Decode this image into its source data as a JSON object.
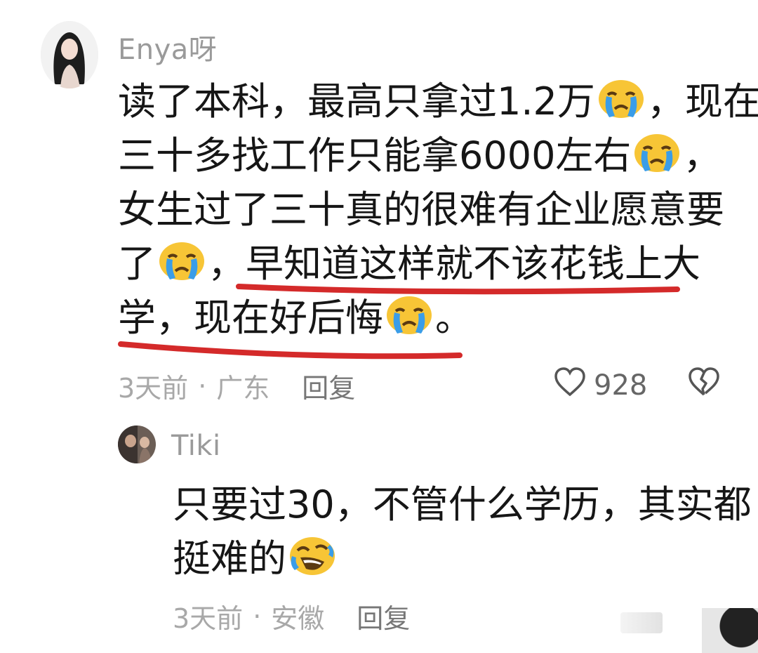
{
  "comments": [
    {
      "username": "Enya呀",
      "lines": [
        {
          "a": "读了本科，最高只拿过1.2万",
          "b": "，现在"
        },
        {
          "a": "三十多找工作只能拿6000左右",
          "b": "，"
        },
        {
          "a": "女生过了三十真的很难有企业愿意要",
          "b": ""
        },
        {
          "a": "了",
          "b": "，早知道这样就不该花钱上大"
        },
        {
          "a": "学，现在好后悔",
          "b": "。"
        }
      ],
      "time": "3天前",
      "dot": "·",
      "location": "广东",
      "reply": "回复",
      "likes": "928"
    },
    {
      "username": "Tiki",
      "lines": [
        {
          "a": "只要过30，不管什么学历，其实都",
          "b": ""
        },
        {
          "a": "挺难的",
          "b": ""
        }
      ],
      "time": "3天前",
      "dot": "·",
      "location": "安徽",
      "reply": "回复"
    }
  ],
  "icons": {
    "crying_emoji": "loudly-crying-face",
    "laughing_emoji": "rolling-on-floor-laughing",
    "like": "heart-outline-icon",
    "dislike": "broken-heart-icon"
  },
  "colors": {
    "underline": "#d42a2a",
    "meta_text": "#a8a8a8",
    "username": "#9a9a9a",
    "emoji_yellow": "#f7c536",
    "tears_blue": "#3a9de8"
  }
}
